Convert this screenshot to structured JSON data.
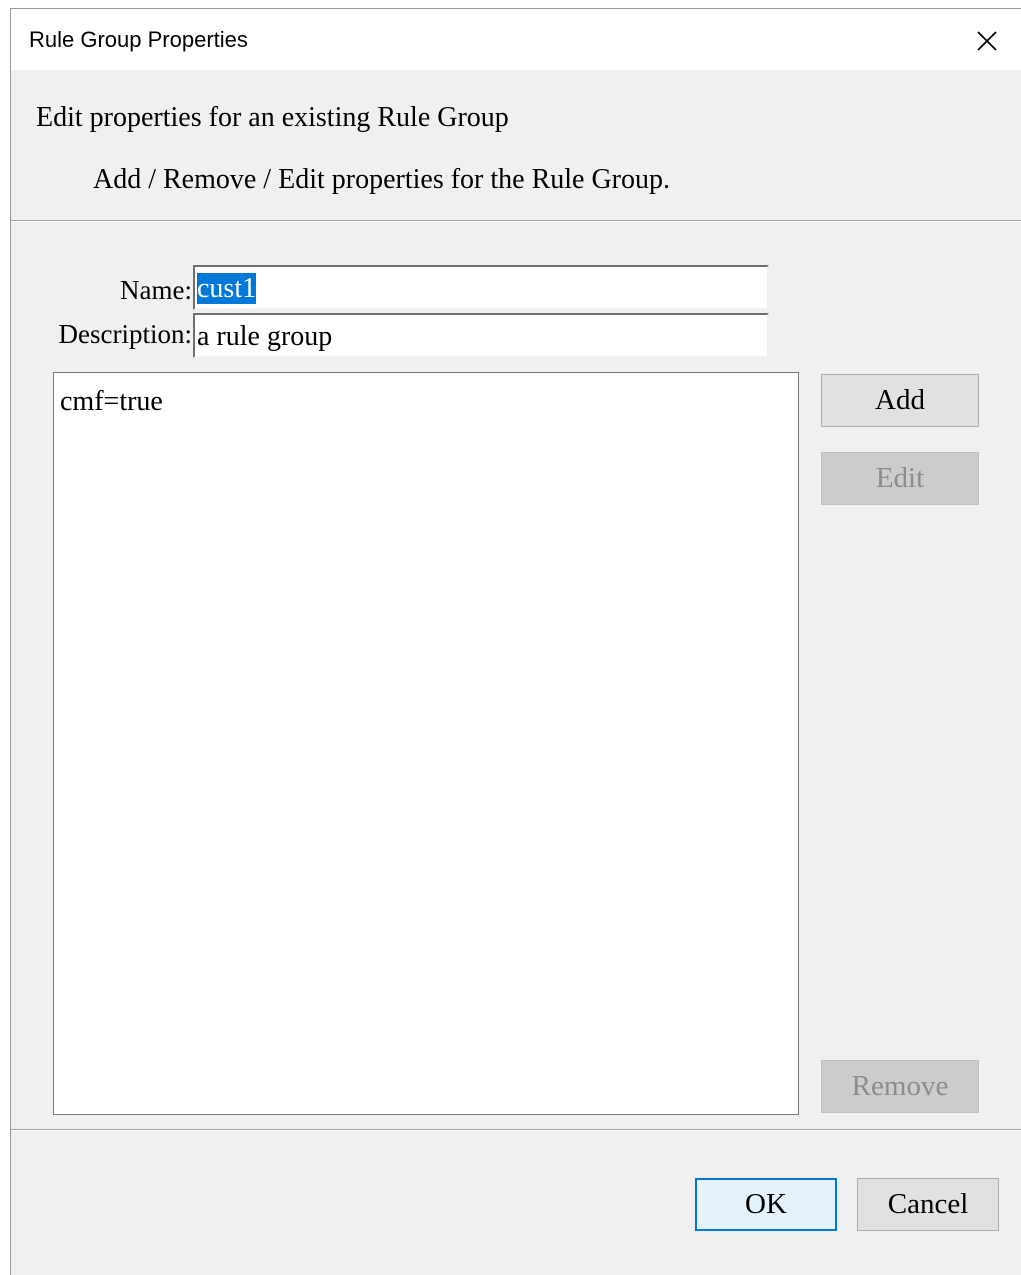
{
  "window": {
    "title": "Rule Group Properties",
    "close_icon": "close-icon"
  },
  "header": {
    "title": "Edit properties for an existing Rule Group",
    "subtitle": "Add / Remove / Edit properties for the Rule Group."
  },
  "form": {
    "name_label": "Name:",
    "name_value": "cust1",
    "description_label": "Description:",
    "description_value": "a rule group"
  },
  "properties": {
    "items": [
      "cmf=true"
    ]
  },
  "buttons": {
    "add": "Add",
    "edit": "Edit",
    "remove": "Remove",
    "ok": "OK",
    "cancel": "Cancel"
  }
}
